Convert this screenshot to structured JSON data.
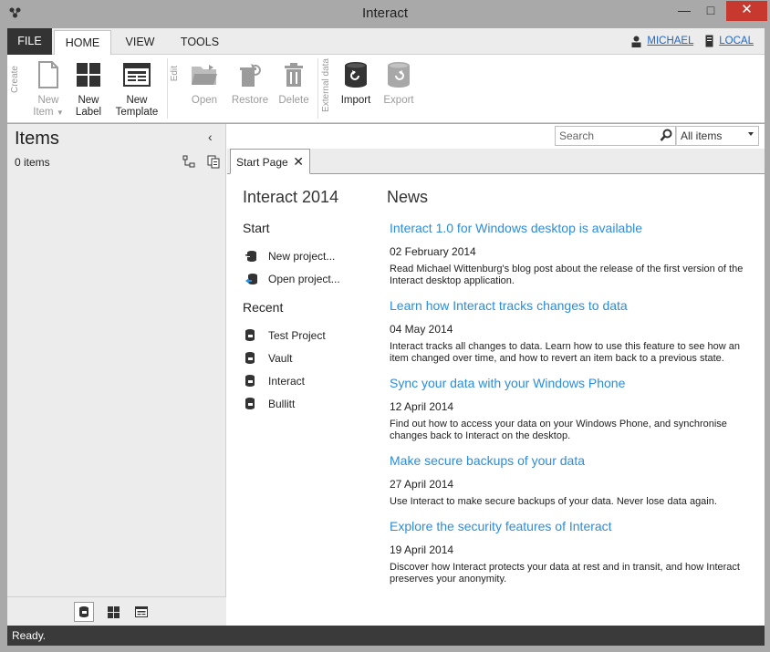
{
  "window": {
    "title": "Interact",
    "minimize": "—",
    "maximize": "□",
    "close": "✕"
  },
  "menu": {
    "file": "FILE",
    "tabs": [
      "HOME",
      "VIEW",
      "TOOLS"
    ],
    "user": "MICHAEL",
    "location": "LOCAL"
  },
  "ribbon": {
    "groups": {
      "create": "Create",
      "edit": "Edit",
      "external": "External data"
    },
    "new_item": [
      "New",
      "Item"
    ],
    "new_label": [
      "New",
      "Label"
    ],
    "new_template": [
      "New",
      "Template"
    ],
    "open": "Open",
    "restore": "Restore",
    "delete": "Delete",
    "import": "Import",
    "export": "Export"
  },
  "items_pane": {
    "title": "Items",
    "collapse": "‹",
    "count": "0 items"
  },
  "search": {
    "placeholder": "Search",
    "filter": "All items"
  },
  "doc_tab": {
    "label": "Start Page",
    "close": "✕"
  },
  "start_page": {
    "title": "Interact 2014",
    "start_heading": "Start",
    "start_items": [
      "New project...",
      "Open project..."
    ],
    "recent_heading": "Recent",
    "recent_items": [
      "Test Project",
      "Vault",
      "Interact",
      "Bullitt"
    ],
    "news_heading": "News",
    "news": [
      {
        "title": "Interact 1.0 for Windows desktop is available",
        "date": "02 February 2014",
        "body": "Read Michael Wittenburg's blog post about the release of the first version of the Interact desktop application."
      },
      {
        "title": "Learn how Interact tracks changes to data",
        "date": "04 May 2014",
        "body": "Interact tracks all changes to data. Learn how to use this feature to see how an item changed over time, and how to revert an item back to a previous state."
      },
      {
        "title": "Sync your data with your Windows Phone",
        "date": "12 April 2014",
        "body": "Find out how to access your data on your Windows Phone, and synchronise changes back to Interact on the desktop."
      },
      {
        "title": "Make secure backups of your data",
        "date": "27 April 2014",
        "body": "Use Interact to make secure backups of your data. Never lose data again."
      },
      {
        "title": "Explore the security features of Interact",
        "date": "19 April 2014",
        "body": "Discover how Interact protects your data at rest and in transit, and how Interact preserves your anonymity."
      }
    ]
  },
  "status": {
    "text": "Ready."
  },
  "colors": {
    "accent": "#2b8ddb",
    "file_tab": "#333333",
    "close_btn": "#c7392e",
    "status_bar": "#3a3a3a"
  }
}
